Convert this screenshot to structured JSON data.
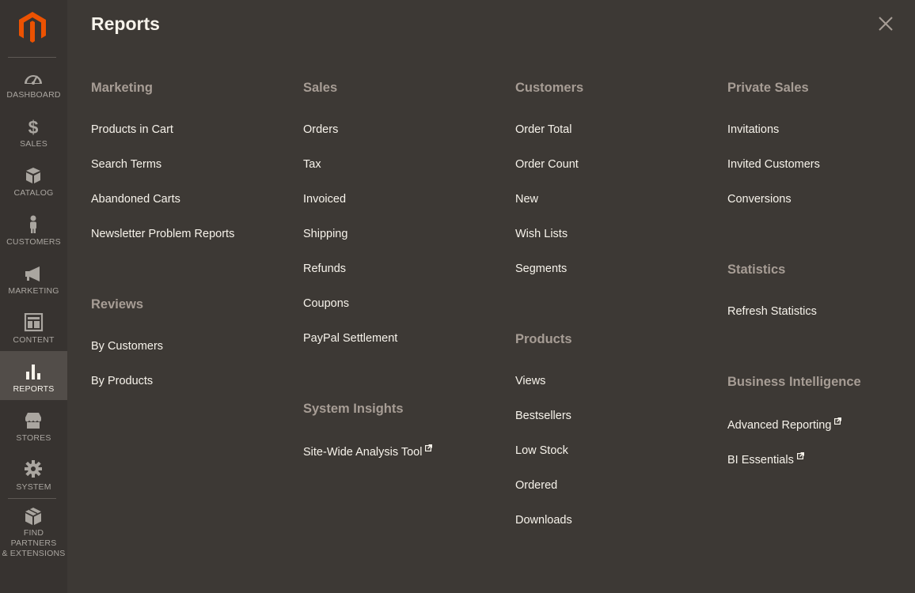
{
  "sidebar": {
    "items": [
      {
        "key": "dashboard",
        "label": "DASHBOARD",
        "icon": "dashboard-icon"
      },
      {
        "key": "sales",
        "label": "SALES",
        "icon": "dollar-icon"
      },
      {
        "key": "catalog",
        "label": "CATALOG",
        "icon": "box-icon"
      },
      {
        "key": "customers",
        "label": "CUSTOMERS",
        "icon": "person-icon"
      },
      {
        "key": "marketing",
        "label": "MARKETING",
        "icon": "megaphone-icon"
      },
      {
        "key": "content",
        "label": "CONTENT",
        "icon": "layout-icon"
      },
      {
        "key": "reports",
        "label": "REPORTS",
        "icon": "bar-chart-icon",
        "active": true
      },
      {
        "key": "stores",
        "label": "STORES",
        "icon": "storefront-icon"
      },
      {
        "key": "system",
        "label": "SYSTEM",
        "icon": "gear-icon"
      }
    ],
    "partners": {
      "line1": "FIND PARTNERS",
      "line2": "& EXTENSIONS",
      "icon": "cube-icon"
    }
  },
  "panel": {
    "title": "Reports",
    "groups": {
      "marketing": {
        "title": "Marketing",
        "items": [
          "Products in Cart",
          "Search Terms",
          "Abandoned Carts",
          "Newsletter Problem Reports"
        ]
      },
      "reviews": {
        "title": "Reviews",
        "items": [
          "By Customers",
          "By Products"
        ]
      },
      "sales": {
        "title": "Sales",
        "items": [
          "Orders",
          "Tax",
          "Invoiced",
          "Shipping",
          "Refunds",
          "Coupons",
          "PayPal Settlement"
        ]
      },
      "system_insights": {
        "title": "System Insights",
        "items": [
          "Site-Wide Analysis Tool"
        ]
      },
      "customers": {
        "title": "Customers",
        "items": [
          "Order Total",
          "Order Count",
          "New",
          "Wish Lists",
          "Segments"
        ]
      },
      "products": {
        "title": "Products",
        "items": [
          "Views",
          "Bestsellers",
          "Low Stock",
          "Ordered",
          "Downloads"
        ]
      },
      "private_sales": {
        "title": "Private Sales",
        "items": [
          "Invitations",
          "Invited Customers",
          "Conversions"
        ]
      },
      "statistics": {
        "title": "Statistics",
        "items": [
          "Refresh Statistics"
        ]
      },
      "business_intelligence": {
        "title": "Business Intelligence",
        "items": [
          "Advanced Reporting",
          "BI Essentials"
        ]
      }
    }
  },
  "colors": {
    "sidebar_bg": "#373330",
    "panel_bg": "#3d3935",
    "active_item_bg": "#524d49",
    "brand_orange": "#eb5202",
    "group_title": "#a79d95",
    "link_text": "#f7f3eb"
  }
}
